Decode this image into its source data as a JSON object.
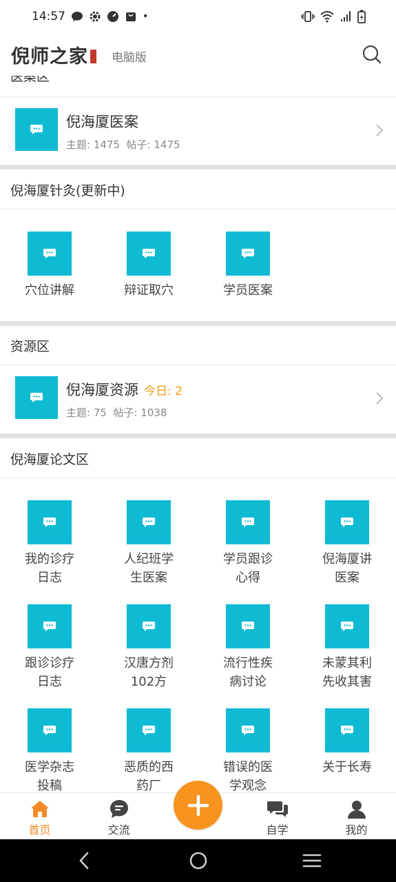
{
  "status_bar": {
    "time": "14:57",
    "dot": "•"
  },
  "header": {
    "logo": "倪师之家",
    "desktop_link": "电脑版",
    "icons": {
      "search": "search-icon"
    }
  },
  "sections": {
    "cases": {
      "title": "医案区",
      "forum": {
        "name": "倪海厦医案",
        "stats": "主题: 1475  帖子: 1475"
      }
    },
    "acupuncture": {
      "title": "倪海厦针灸(更新中)",
      "items": [
        "穴位讲解",
        "辩证取穴",
        "学员医案"
      ]
    },
    "resources": {
      "title": "资源区",
      "forum": {
        "name": "倪海厦资源",
        "today": "今日: 2",
        "stats": "主题: 75  帖子: 1038"
      }
    },
    "papers": {
      "title": "倪海厦论文区",
      "items": [
        {
          "line1": "我的诊疗",
          "line2": "日志"
        },
        {
          "line1": "人纪班学",
          "line2": "生医案"
        },
        {
          "line1": "学员跟诊",
          "line2": "心得"
        },
        {
          "line1": "倪海厦讲",
          "line2": "医案"
        },
        {
          "line1": "跟诊诊疗",
          "line2": "日志"
        },
        {
          "line1": "汉唐方剂",
          "line2": "102方"
        },
        {
          "line1": "流行性疾",
          "line2": "病讨论"
        },
        {
          "line1": "未蒙其利",
          "line2": "先收其害"
        },
        {
          "line1": "医学杂志",
          "line2": "投稿"
        },
        {
          "line1": "恶质的西",
          "line2": "药厂"
        },
        {
          "line1": "错误的医",
          "line2": "学观念"
        },
        {
          "line1": "关于长寿",
          "line2": ""
        }
      ]
    }
  },
  "bottom_nav": {
    "home": "首页",
    "chat": "交流",
    "study": "自学",
    "mine": "我的"
  },
  "colors": {
    "accent": "#f58a26",
    "tile": "#0fbbd3",
    "today": "#f39c12",
    "fab": "#f7931e"
  }
}
